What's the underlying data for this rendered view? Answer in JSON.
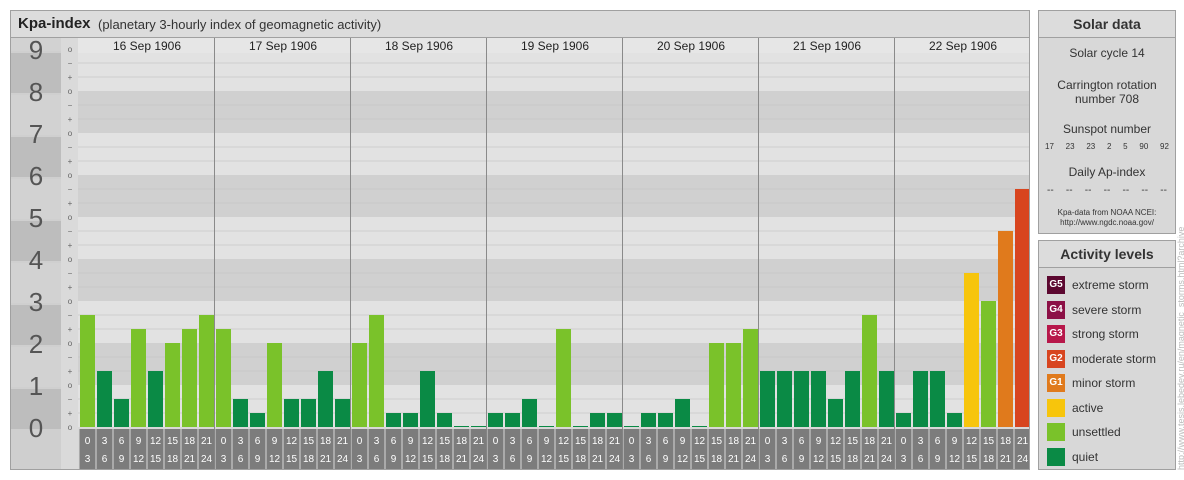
{
  "main": {
    "title": "Kpa-index",
    "subtitle": "(planetary 3-hourly index of geomagnetic activity)"
  },
  "chart_data": {
    "type": "bar",
    "ylim": [
      0,
      9
    ],
    "y_tick_labels": [
      "0",
      "1",
      "2",
      "3",
      "4",
      "5",
      "6",
      "7",
      "8",
      "9"
    ],
    "sub_tick_labels": [
      "o",
      "+",
      "−",
      "o",
      "+",
      "−",
      "o",
      "+",
      "−",
      "o",
      "+",
      "−",
      "o",
      "+",
      "−",
      "o",
      "+",
      "−",
      "o",
      "+",
      "−",
      "o",
      "+",
      "−",
      "o",
      "+",
      "−",
      "o"
    ],
    "days": [
      "16 Sep 1906",
      "17 Sep 1906",
      "18 Sep 1906",
      "19 Sep 1906",
      "20 Sep 1906",
      "21 Sep 1906",
      "22 Sep 1906"
    ],
    "slot_labels": [
      [
        "0",
        "3"
      ],
      [
        "3",
        "6"
      ],
      [
        "6",
        "9"
      ],
      [
        "9",
        "12"
      ],
      [
        "12",
        "15"
      ],
      [
        "15",
        "18"
      ],
      [
        "18",
        "21"
      ],
      [
        "21",
        "24"
      ]
    ],
    "values": [
      2.667,
      1.333,
      0.667,
      2.333,
      1.333,
      2.0,
      2.333,
      2.667,
      2.333,
      0.667,
      0.333,
      2.0,
      0.667,
      0.667,
      1.333,
      0.667,
      2.0,
      2.667,
      0.333,
      0.333,
      1.333,
      0.333,
      0.0,
      0.0,
      0.333,
      0.333,
      0.667,
      0.0,
      2.333,
      0.0,
      0.333,
      0.333,
      0.0,
      0.333,
      0.333,
      0.667,
      0.0,
      2.0,
      2.0,
      2.333,
      1.333,
      1.333,
      1.333,
      1.333,
      0.667,
      1.333,
      2.667,
      1.333,
      0.333,
      1.333,
      1.333,
      0.333,
      3.667,
      3.0,
      4.667,
      5.667
    ],
    "colors": {
      "quiet": "#0a8a45",
      "unsettled": "#7ac22a",
      "active": "#f7c50c",
      "g1": "#e07a1c",
      "g2": "#d8451f",
      "g3": "#b7174a",
      "g4": "#8c1046",
      "g5": "#5c0830"
    },
    "grid": true
  },
  "solar": {
    "heading": "Solar data",
    "cycle": "Solar cycle 14",
    "carrington_line1": "Carrington rotation",
    "carrington_line2": "number 708",
    "sunspot_label": "Sunspot number",
    "sunspot_values": [
      "17",
      "23",
      "23",
      "2",
      "5",
      "90",
      "92"
    ],
    "ap_label": "Daily Ap-index",
    "ap_values": [
      "--",
      "--",
      "--",
      "--",
      "--",
      "--",
      "--"
    ],
    "source_line1": "Kpa-data from NOAA NCEI:",
    "source_line2": "http://www.ngdc.noaa.gov/"
  },
  "levels": {
    "heading": "Activity levels",
    "items": [
      {
        "badge": "G5",
        "label": "extreme storm",
        "color": "#5c0830"
      },
      {
        "badge": "G4",
        "label": "severe storm",
        "color": "#8c1046"
      },
      {
        "badge": "G3",
        "label": "strong storm",
        "color": "#b7174a"
      },
      {
        "badge": "G2",
        "label": "moderate storm",
        "color": "#d8451f"
      },
      {
        "badge": "G1",
        "label": "minor storm",
        "color": "#e07a1c"
      },
      {
        "badge": "",
        "label": "active",
        "color": "#f7c50c"
      },
      {
        "badge": "",
        "label": "unsettled",
        "color": "#7ac22a"
      },
      {
        "badge": "",
        "label": "quiet",
        "color": "#0a8a45"
      }
    ]
  },
  "watermark": "http://www.tesis.lebedev.ru/en/magnetic_storms.html?archive"
}
